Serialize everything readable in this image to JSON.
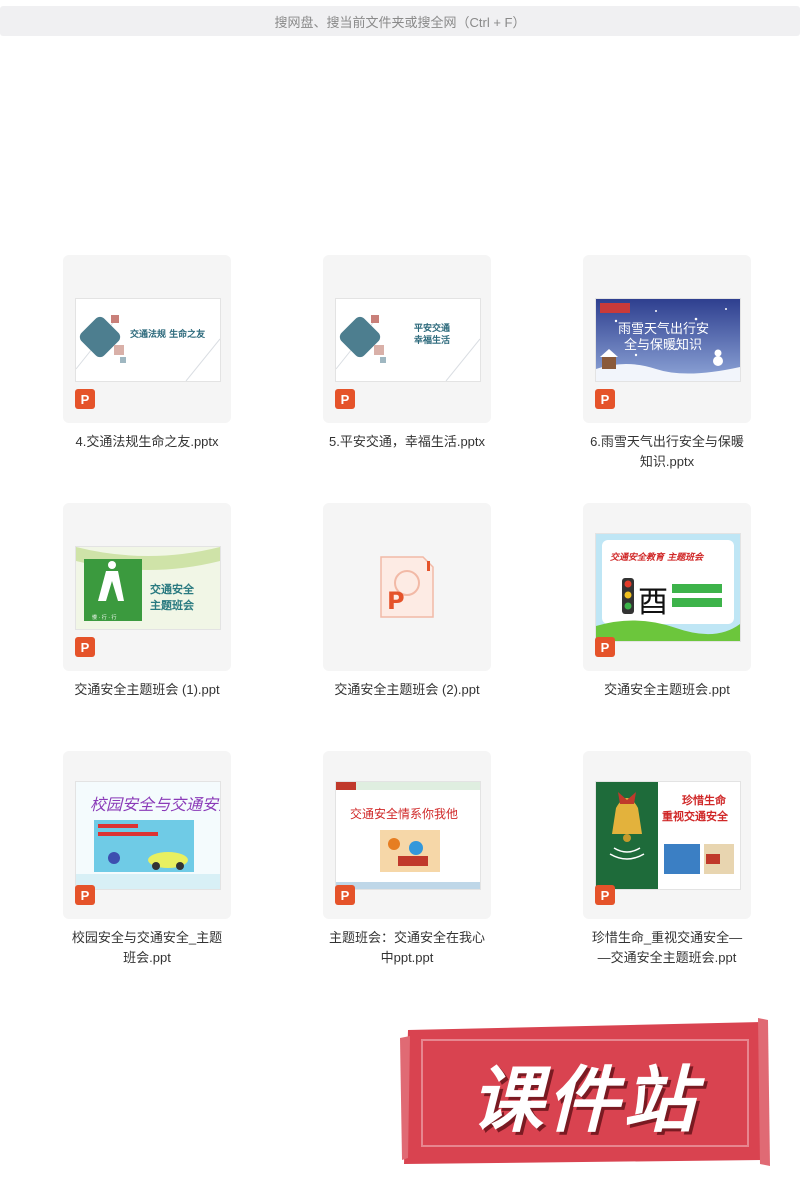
{
  "search": {
    "placeholder": "搜网盘、搜当前文件夹或搜全网（Ctrl + F）"
  },
  "badge_letter": "P",
  "files": [
    {
      "name": "4.交通法规生命之友.pptx",
      "thumb_title": "交通法规  生命之友"
    },
    {
      "name": "5.平安交通，幸福生活.pptx",
      "thumb_title_line1": "平安交通",
      "thumb_title_line2": "幸福生活"
    },
    {
      "name_line1": "6.雨雪天气出行安全与保暖",
      "name_line2": "知识.pptx",
      "thumb_title_line1": "雨雪天气出行安",
      "thumb_title_line2": "全与保暖知识"
    },
    {
      "name": "交通安全主题班会 (1).ppt",
      "thumb_title_line1": "交通安全",
      "thumb_title_line2": "主题班会",
      "thumb_sub": "慢 · 行 · 行"
    },
    {
      "name": "交通安全主题班会 (2).ppt"
    },
    {
      "name": "交通安全主题班会.ppt",
      "thumb_title": "交通安全教育 主题班会",
      "thumb_char": "酉"
    },
    {
      "name_line1": "校园安全与交通安全_主题",
      "name_line2": "班会.ppt",
      "thumb_title": "校园安全与交通安全"
    },
    {
      "name_line1": "主题班会：交通安全在我心",
      "name_line2": "中ppt.ppt",
      "thumb_title": "交通安全情系你我他"
    },
    {
      "name_line1": "珍惜生命_重视交通安全—",
      "name_line2": "—交通安全主题班会.ppt",
      "thumb_title_line1": "珍惜生命",
      "thumb_title_line2": "重视交通安全"
    }
  ],
  "watermark": {
    "text": "课件站"
  },
  "colors": {
    "ppt_orange": "#e5532a",
    "watermark_red": "#d94350"
  }
}
